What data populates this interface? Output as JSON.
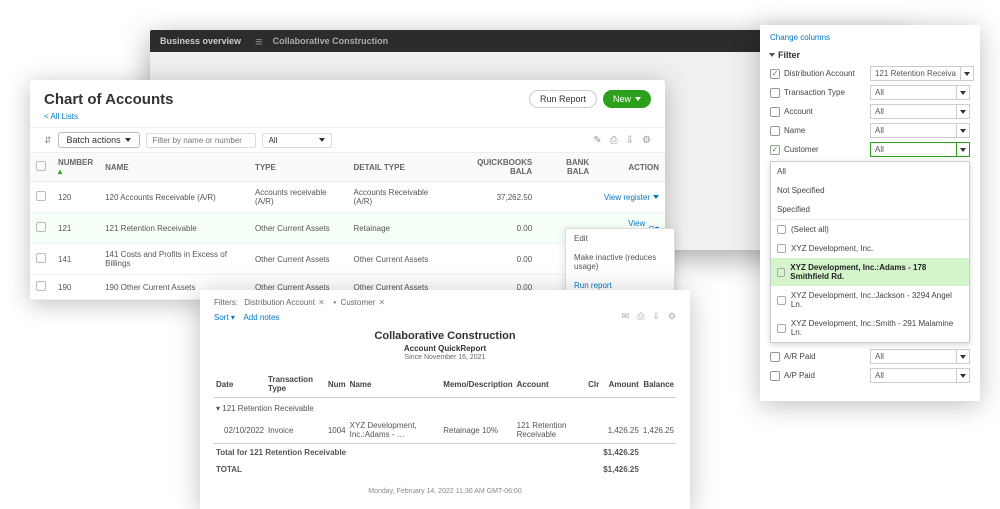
{
  "bg": {
    "overview": "Business overview",
    "company": "Collaborative Construction",
    "qr_title": "Account QuickReport",
    "qr_sub": "Since November 16, 2021",
    "ction": "ction"
  },
  "coa": {
    "title": "Chart of Accounts",
    "all_lists": "< All Lists",
    "run_report": "Run Report",
    "new": "New",
    "batch": "Batch actions",
    "search_ph": "Filter by name or number",
    "all": "All",
    "cols": {
      "number": "NUMBER",
      "name": "NAME",
      "type": "TYPE",
      "detail": "DETAIL TYPE",
      "qb": "QUICKBOOKS BALA",
      "bank": "BANK BALA",
      "action": "ACTION"
    },
    "rows": [
      {
        "num": "120",
        "name": "120 Accounts Receivable (A/R)",
        "type": "Accounts receivable (A/R)",
        "detail": "Accounts Receivable (A/R)",
        "qb": "37,262.50",
        "bank": "",
        "action": "View register"
      },
      {
        "num": "121",
        "name": "121 Retention Receivable",
        "type": "Other Current Assets",
        "detail": "Retainage",
        "qb": "0.00",
        "bank": "",
        "action": "View register"
      },
      {
        "num": "141",
        "name": "141 Costs and Profits in Excess of Billings",
        "type": "Other Current Assets",
        "detail": "Other Current Assets",
        "qb": "0.00",
        "bank": "",
        "action": ""
      },
      {
        "num": "190",
        "name": "190 Other Current Assets",
        "type": "Other Current Assets",
        "detail": "Other Current Assets",
        "qb": "0.00",
        "bank": "",
        "action": ""
      }
    ],
    "menu": {
      "edit": "Edit",
      "inactive": "Make inactive (reduces usage)",
      "run": "Run report"
    }
  },
  "report": {
    "filters_label": "Filters:",
    "f1": "Distribution Account",
    "f2": "Customer",
    "sort": "Sort ▾",
    "addnotes": "Add notes",
    "company": "Collaborative Construction",
    "title": "Account QuickReport",
    "since": "Since November 16, 2021",
    "cols": {
      "date": "Date",
      "ttype": "Transaction Type",
      "num": "Num",
      "name": "Name",
      "memo": "Memo/Description",
      "acct": "Account",
      "clr": "Clr",
      "amount": "Amount",
      "bal": "Balance"
    },
    "group": "▾ 121 Retention Receivable",
    "row": {
      "date": "02/10/2022",
      "ttype": "Invoice",
      "num": "1004",
      "name": "XYZ Development, Inc.:Adams - …",
      "memo": "Retainage 10%",
      "acct": "121 Retention Receivable",
      "clr": "",
      "amount": "1,426.25",
      "bal": "1,426.25"
    },
    "total_label": "Total for 121 Retention Receivable",
    "total_amount": "$1,426.25",
    "grand_label": "TOTAL",
    "grand_amount": "$1,426.25",
    "footer": "Monday, February 14, 2022  11:30 AM GMT-06:00"
  },
  "filters": {
    "change": "Change columns",
    "head": "Filter",
    "rows": [
      {
        "key": "dist",
        "label": "Distribution Account",
        "checked": true,
        "value": "121 Retention Receiva"
      },
      {
        "key": "ttype",
        "label": "Transaction Type",
        "checked": false,
        "value": "All"
      },
      {
        "key": "acct",
        "label": "Account",
        "checked": false,
        "value": "All"
      },
      {
        "key": "name",
        "label": "Name",
        "checked": false,
        "value": "All"
      },
      {
        "key": "cust",
        "label": "Customer",
        "checked": true,
        "value": "All",
        "active": true
      }
    ],
    "dropdown": {
      "all": "All",
      "notspec": "Not Specified",
      "spec": "Specified",
      "selectall": "(Select all)",
      "opts": [
        "XYZ Development, Inc.",
        "XYZ Development, Inc.:Adams - 178 Smithfield Rd.",
        "XYZ Development, Inc.:Jackson - 3294 Angel Ln.",
        "XYZ Development, Inc.:Smith - 291 Malamine Ln."
      ],
      "selected_index": 1
    },
    "rows2": [
      {
        "key": "arpaid",
        "label": "A/R Paid",
        "value": "All"
      },
      {
        "key": "appaid",
        "label": "A/P Paid",
        "value": "All"
      }
    ]
  }
}
